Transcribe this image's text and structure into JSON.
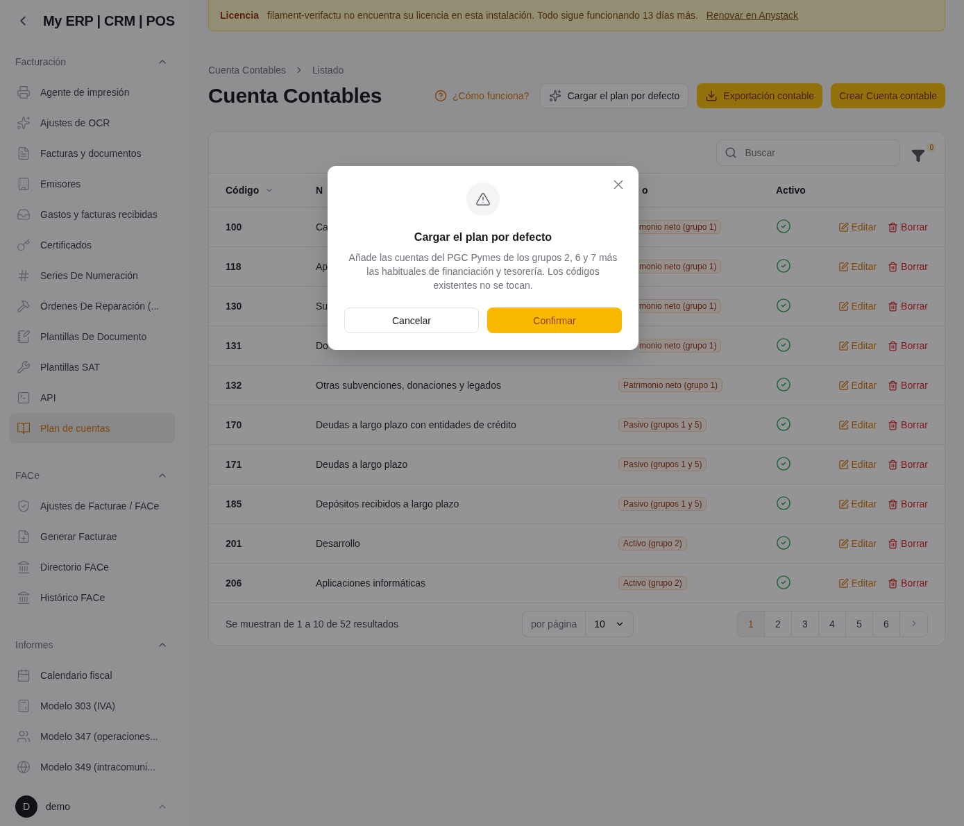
{
  "sidebar": {
    "brand": "My ERP | CRM | POS",
    "sections": [
      {
        "title": "Facturación",
        "expanded": true,
        "items": [
          {
            "label": "Agente de impresión",
            "selected": false
          },
          {
            "label": "Ajustes de OCR",
            "selected": false
          },
          {
            "label": "Facturas y documentos",
            "selected": false
          },
          {
            "label": "Emisores",
            "selected": false
          },
          {
            "label": "Gastos y facturas recibidas",
            "selected": false
          },
          {
            "label": "Certificados",
            "selected": false
          },
          {
            "label": "Series De Numeración",
            "selected": false
          },
          {
            "label": "Órdenes De Reparación (...",
            "selected": false
          },
          {
            "label": "Plantillas De Documento",
            "selected": false
          },
          {
            "label": "Plantillas SAT",
            "selected": false
          },
          {
            "label": "API",
            "selected": false
          },
          {
            "label": "Plan de cuentas",
            "selected": true
          }
        ]
      },
      {
        "title": "FACe",
        "expanded": true,
        "items": [
          {
            "label": "Ajustes de Facturae / FACe",
            "selected": false
          },
          {
            "label": "Generar Facturae",
            "selected": false
          },
          {
            "label": "Directorio FACe",
            "selected": false
          },
          {
            "label": "Histórico FACe",
            "selected": false
          }
        ]
      },
      {
        "title": "Informes",
        "expanded": true,
        "items": [
          {
            "label": "Calendario fiscal",
            "selected": false
          },
          {
            "label": "Modelo 303 (IVA)",
            "selected": false
          },
          {
            "label": "Modelo 347 (operaciones...",
            "selected": false
          },
          {
            "label": "Modelo 349 (intracomuni...",
            "selected": false
          }
        ]
      }
    ],
    "user": {
      "initial": "D",
      "name": "demo",
      "expanded": true
    }
  },
  "banner": {
    "title": "Licencia",
    "message": "filament-verifactu no encuentra su licencia en esta instalación. Todo sigue funcionando 13 días más.",
    "link": "Renovar en Anystack"
  },
  "breadcrumbs": [
    "Cuenta Contables",
    "Listado"
  ],
  "page_title": "Cuenta Contables",
  "header_actions": [
    {
      "label": "¿Cómo funciona?",
      "kind": "link"
    },
    {
      "label": "Cargar el plan por defecto",
      "kind": "outline"
    },
    {
      "label": "Exportación contable",
      "kind": "primary-icon"
    },
    {
      "label": "Crear Cuenta contable",
      "kind": "primary"
    }
  ],
  "table": {
    "search": {
      "placeholder": "Buscar"
    },
    "filter_count": "0",
    "columns": [
      {
        "label": "Código",
        "sortable": true,
        "clipped": false
      },
      {
        "label": "N",
        "sortable": false,
        "clipped": false
      },
      {
        "label": "o",
        "sortable": false,
        "clipped": true
      },
      {
        "label": "Activo",
        "sortable": false,
        "clipped": false
      }
    ],
    "rows": [
      {
        "code": "100",
        "name": "Ca",
        "type": "monio neto (grupo 1)",
        "type_clipped": true,
        "active": true,
        "actions": [
          "Editar",
          "Borrar"
        ]
      },
      {
        "code": "118",
        "name": "Ap",
        "type": "monio neto (grupo 1)",
        "type_clipped": true,
        "active": true,
        "actions": [
          "Editar",
          "Borrar"
        ]
      },
      {
        "code": "130",
        "name": "Su",
        "type": "monio neto (grupo 1)",
        "type_clipped": true,
        "active": true,
        "actions": [
          "Editar",
          "Borrar"
        ]
      },
      {
        "code": "131",
        "name": "Do",
        "type": "monio neto (grupo 1)",
        "type_clipped": true,
        "active": true,
        "actions": [
          "Editar",
          "Borrar"
        ]
      },
      {
        "code": "132",
        "name": "Otras subvenciones, donaciones y legados",
        "type": "Patrimonio neto (grupo 1)",
        "type_clipped": false,
        "active": true,
        "actions": [
          "Editar",
          "Borrar"
        ]
      },
      {
        "code": "170",
        "name": "Deudas a largo plazo con entidades de crédito",
        "type": "Pasivo (grupos 1 y 5)",
        "type_clipped": false,
        "active": true,
        "actions": [
          "Editar",
          "Borrar"
        ]
      },
      {
        "code": "171",
        "name": "Deudas a largo plazo",
        "type": "Pasivo (grupos 1 y 5)",
        "type_clipped": false,
        "active": true,
        "actions": [
          "Editar",
          "Borrar"
        ]
      },
      {
        "code": "185",
        "name": "Depósitos recibidos a largo plazo",
        "type": "Pasivo (grupos 1 y 5)",
        "type_clipped": false,
        "active": true,
        "actions": [
          "Editar",
          "Borrar"
        ]
      },
      {
        "code": "201",
        "name": "Desarrollo",
        "type": "Activo (grupo 2)",
        "type_clipped": false,
        "active": true,
        "actions": [
          "Editar",
          "Borrar"
        ]
      },
      {
        "code": "206",
        "name": "Aplicaciones informáticas",
        "type": "Activo (grupo 2)",
        "type_clipped": false,
        "active": true,
        "actions": [
          "Editar",
          "Borrar"
        ]
      }
    ],
    "summary": "Se muestran de 1 a 10 de 52 resultados",
    "per_page_label": "por página",
    "per_page": "10",
    "pages": [
      {
        "label": "1",
        "selected": true
      },
      {
        "label": "2",
        "selected": false
      },
      {
        "label": "3",
        "selected": false
      },
      {
        "label": "4",
        "selected": false
      },
      {
        "label": "5",
        "selected": false
      },
      {
        "label": "6",
        "selected": false
      }
    ]
  },
  "modal": {
    "title": "Cargar el plan por defecto",
    "message": "Añade las cuentas del PGC Pymes de los grupos 2, 6 y 7 más las habituales de financiación y tesorería. Los códigos existentes no se tocan.",
    "buttons": [
      {
        "label": "Cancelar",
        "kind": "secondary"
      },
      {
        "label": "Confirmar",
        "kind": "primary"
      }
    ]
  }
}
